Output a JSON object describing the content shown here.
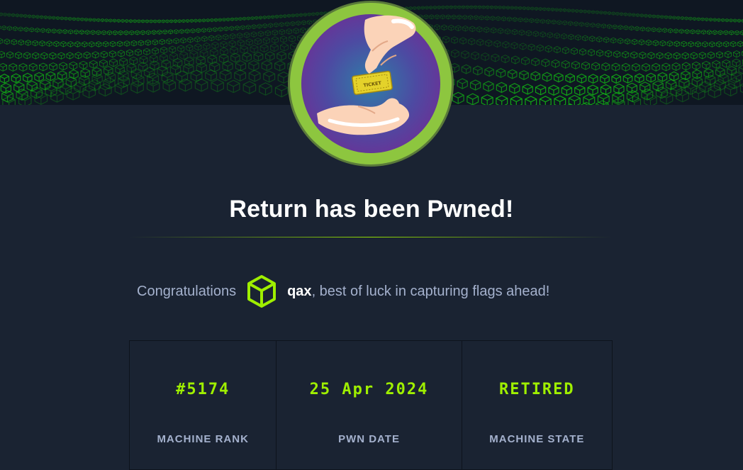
{
  "banner": {
    "pattern": "green-wireframe-cube-wave",
    "accent_color": "#12d612"
  },
  "machine": {
    "avatar_icon": "hand-passing-ticket-icon",
    "avatar_ticket_text": "TICKET",
    "ring_color": "#8dc63f"
  },
  "page": {
    "title": "Return has been Pwned!"
  },
  "congrats": {
    "lead": "Congratulations",
    "icon": "cube-icon",
    "username": "qax",
    "tail": ", best of luck in capturing flags ahead!"
  },
  "stats": [
    {
      "value": "#5174",
      "label": "MACHINE RANK"
    },
    {
      "value": "25 Apr 2024",
      "label": "PWN DATE"
    },
    {
      "value": "RETIRED",
      "label": "MACHINE STATE"
    }
  ],
  "colors": {
    "background": "#1a2332",
    "accent": "#9fef00",
    "muted_text": "#a4b1cd"
  }
}
